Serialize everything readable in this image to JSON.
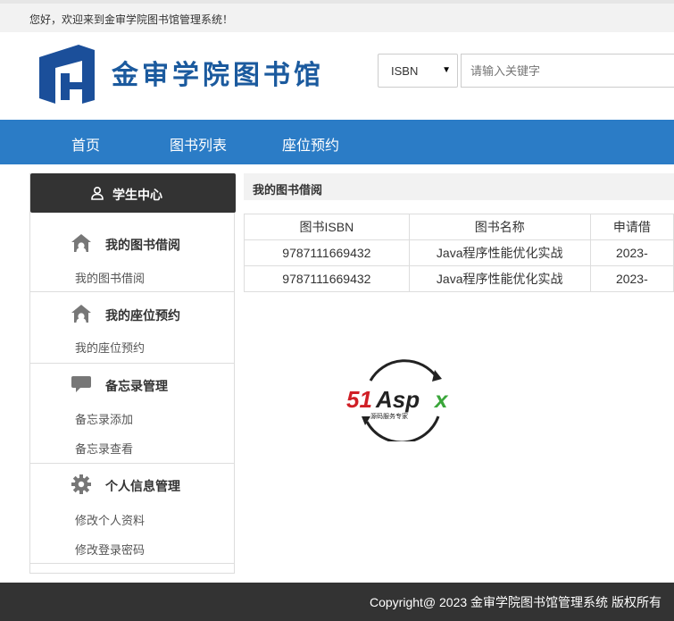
{
  "topbar": {
    "welcome": "您好，欢迎来到金审学院图书馆管理系统！"
  },
  "header": {
    "site_name": "金审学院图书馆",
    "logo_icon": "library-logo-icon",
    "brand_color": "#1b5a9e"
  },
  "search": {
    "type_selected": "ISBN",
    "placeholder": "请输入关键字"
  },
  "nav": {
    "bg_color": "#2b7cc6",
    "items": [
      {
        "label": "首页"
      },
      {
        "label": "图书列表"
      },
      {
        "label": "座位预约"
      }
    ]
  },
  "sidebar": {
    "header": {
      "label": "学生中心",
      "icon": "user-icon"
    },
    "sections": [
      {
        "title": "我的图书借阅",
        "icon": "home-icon",
        "links": [
          "我的图书借阅"
        ]
      },
      {
        "title": "我的座位预约",
        "icon": "home-icon",
        "links": [
          "我的座位预约"
        ]
      },
      {
        "title": "备忘录管理",
        "icon": "comment-icon",
        "links": [
          "备忘录添加",
          "备忘录查看"
        ]
      },
      {
        "title": "个人信息管理",
        "icon": "gear-icon",
        "links": [
          "修改个人资料",
          "修改登录密码"
        ]
      }
    ]
  },
  "main": {
    "title": "我的图书借阅",
    "table": {
      "headers": [
        "图书ISBN",
        "图书名称",
        "申请借"
      ],
      "rows": [
        [
          "9787111669432",
          "Java程序性能优化实战",
          "2023-"
        ],
        [
          "9787111669432",
          "Java程序性能优化实战",
          "2023-"
        ]
      ]
    }
  },
  "watermark": {
    "text": "51Aspx",
    "subtitle": "源码服务专家"
  },
  "footer": {
    "copyright": "Copyright@ 2023 金审学院图书馆管理系统 版权所有"
  }
}
